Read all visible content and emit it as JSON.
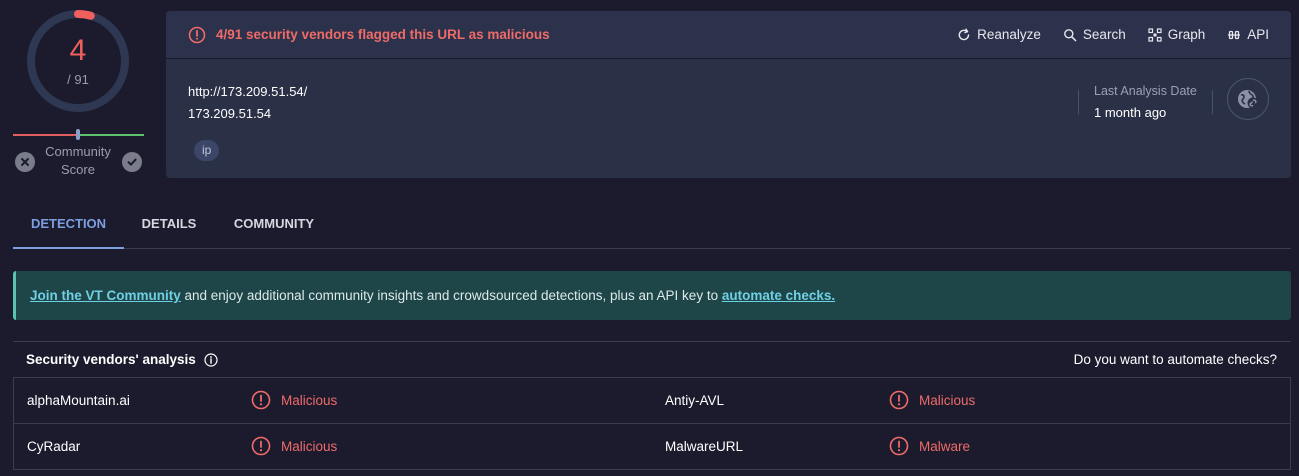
{
  "score": {
    "detections": "4",
    "total": "/ 91",
    "ring_fraction": 0.044,
    "community_label": "Community\nScore"
  },
  "summary": {
    "alert": "4/91 security vendors flagged this URL as malicious",
    "actions": [
      {
        "label": "Reanalyze",
        "icon": "reanalyze-icon"
      },
      {
        "label": "Search",
        "icon": "search-icon"
      },
      {
        "label": "Graph",
        "icon": "graph-icon"
      },
      {
        "label": "API",
        "icon": "api-icon"
      }
    ],
    "url": "http://173.209.51.54/",
    "host": "173.209.51.54",
    "tag": "ip",
    "last_analysis_label": "Last Analysis Date",
    "last_analysis_value": "1 month ago"
  },
  "tabs": [
    "DETECTION",
    "DETAILS",
    "COMMUNITY"
  ],
  "banner": {
    "link1": "Join the VT Community",
    "middle": " and enjoy additional community insights and crowdsourced detections, plus an API key to ",
    "link2": "automate checks."
  },
  "vendors": {
    "title": "Security vendors' analysis",
    "automate": "Do you want to automate checks?",
    "rows": [
      [
        {
          "name": "alphaMountain.ai",
          "verdict": "Malicious"
        },
        {
          "name": "Antiy-AVL",
          "verdict": "Malicious"
        }
      ],
      [
        {
          "name": "CyRadar",
          "verdict": "Malicious"
        },
        {
          "name": "MalwareURL",
          "verdict": "Malware"
        }
      ]
    ]
  },
  "colors": {
    "malicious": "#ee6b68",
    "accent": "#7d9fe0",
    "background": "#1c1b2d",
    "panel": "#2a3046"
  }
}
